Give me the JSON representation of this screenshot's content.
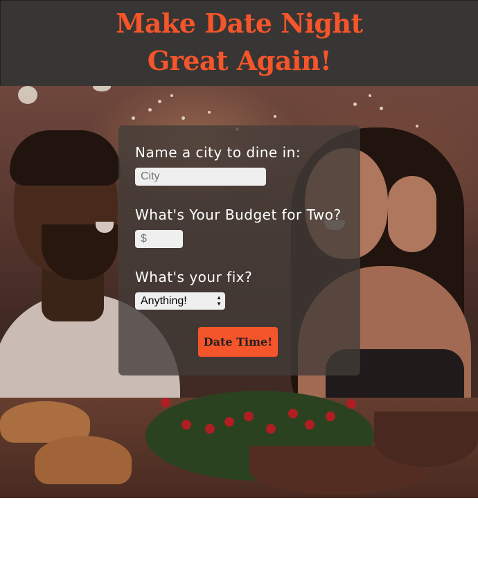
{
  "header": {
    "title_line1": "Make Date Night",
    "title_line2": "Great Again!"
  },
  "form": {
    "city_label": "Name a city to dine in:",
    "city_placeholder": "City",
    "budget_label": "What's Your Budget for Two?",
    "budget_placeholder": "$",
    "fix_label": "What's your fix?",
    "fix_selected": "Anything!",
    "submit_label": "Date Time!"
  },
  "colors": {
    "accent": "#f5552a",
    "header_bg": "#383634",
    "card_bg": "#423c38"
  },
  "icons": {
    "select_arrows": "updown-chevron-icon"
  }
}
